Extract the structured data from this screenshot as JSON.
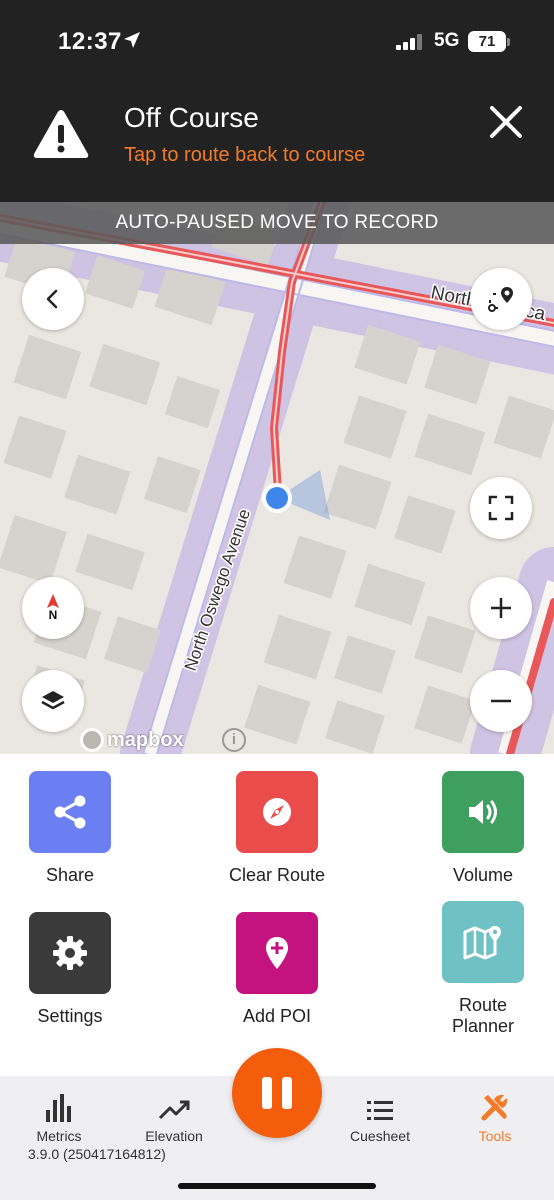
{
  "status_bar": {
    "time": "12:37",
    "network": "5G",
    "battery": "71"
  },
  "banner": {
    "title": "Off Course",
    "subtitle": "Tap to route back to course",
    "accent": "#f27a28"
  },
  "map": {
    "autopause_text": "AUTO-PAUSED MOVE TO RECORD",
    "street_labels": [
      "North Oswego Avenue",
      "North Seneca"
    ],
    "compass_label": "N",
    "attribution": "mapbox",
    "info_label": "i",
    "route_color": "#e8585a"
  },
  "tools": [
    {
      "label": "Share",
      "icon": "share-icon",
      "color": "#6c7ff2"
    },
    {
      "label": "Clear Route",
      "icon": "compass-icon",
      "color": "#ea4c4c"
    },
    {
      "label": "Volume",
      "icon": "volume-icon",
      "color": "#3f9f5f"
    },
    {
      "label": "Settings",
      "icon": "gear-icon",
      "color": "#3a3a3a"
    },
    {
      "label": "Add POI",
      "icon": "map-pin-plus-icon",
      "color": "#c4137f"
    },
    {
      "label": "Route Planner",
      "icon": "map-icon",
      "color": "#6fc1c4"
    }
  ],
  "bottom_nav": {
    "items": [
      {
        "label": "Metrics",
        "icon": "bar-chart-icon"
      },
      {
        "label": "Elevation",
        "icon": "trend-up-icon"
      },
      {
        "label": "Cuesheet",
        "icon": "list-icon"
      },
      {
        "label": "Tools",
        "icon": "tools-icon",
        "active_color": "#f27a28"
      }
    ],
    "version": "3.9.0 (250417164812)",
    "pause_color": "#f45d0b"
  }
}
